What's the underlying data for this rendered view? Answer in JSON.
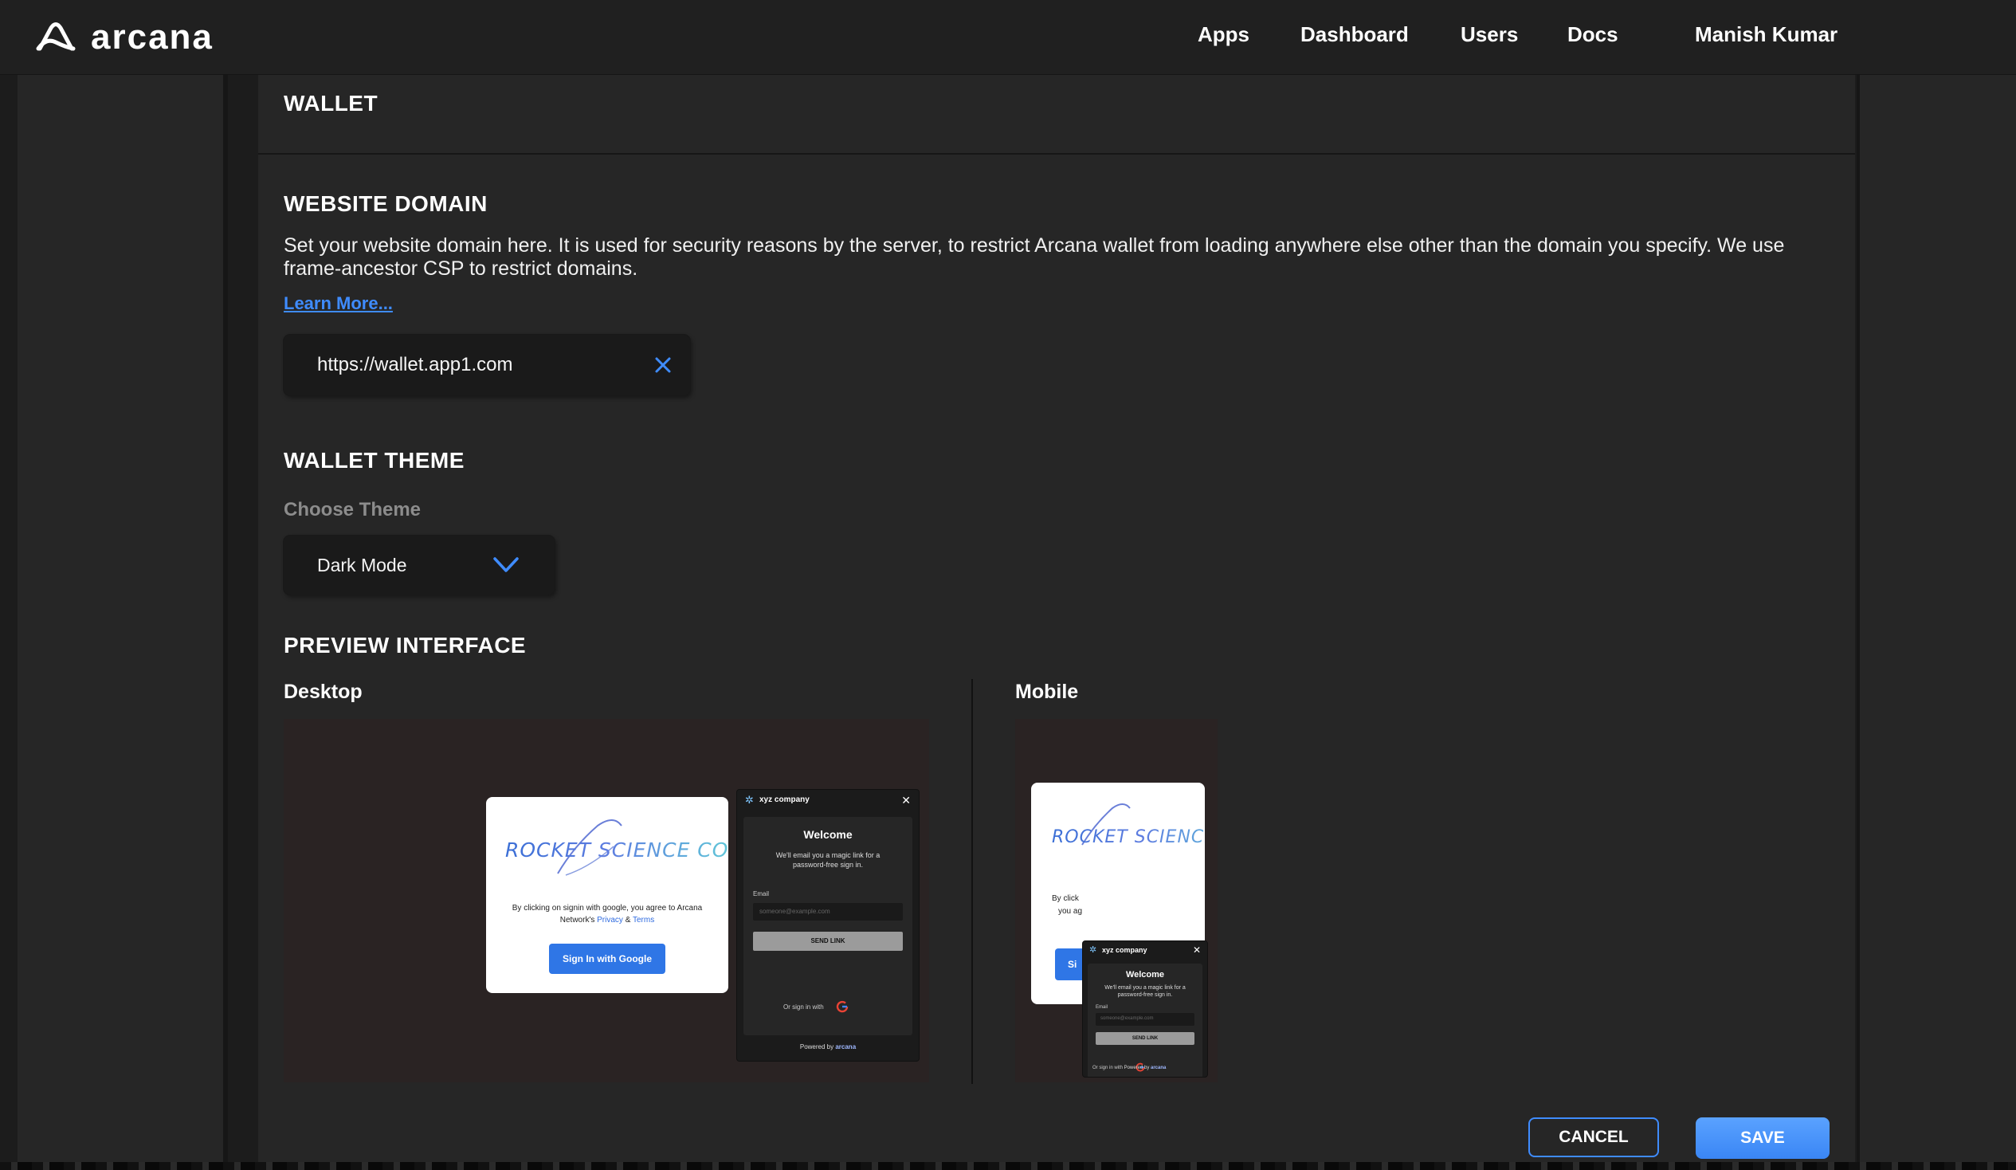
{
  "header": {
    "brand": "arcana",
    "nav": [
      "Apps",
      "Dashboard",
      "Users",
      "Docs"
    ],
    "user": "Manish Kumar"
  },
  "section_title": "WALLET",
  "website_domain": {
    "heading": "WEBSITE DOMAIN",
    "description": "Set your website domain here. It is used for security reasons by the server, to restrict Arcana wallet from loading anywhere else other than the domain you specify. We use frame-ancestor CSP to restrict domains.",
    "learn_more": "Learn More...",
    "value": "https://wallet.app1.com"
  },
  "wallet_theme": {
    "heading": "WALLET THEME",
    "label": "Choose Theme",
    "selected": "Dark Mode"
  },
  "preview": {
    "heading": "PREVIEW INTERFACE",
    "desktop_label": "Desktop",
    "mobile_label": "Mobile",
    "app": {
      "logo": "ROCKET SCIENCE CO.",
      "consent_prefix": "By clicking on signin with google, you agree to Arcana Network's",
      "privacy": "Privacy",
      "amp": "&",
      "terms": "Terms",
      "google_button": "Sign In with Google",
      "mobile_consent_fragment": "By click",
      "mobile_consent_fragment2": "you ag",
      "mobile_button_fragment": "Si"
    },
    "wallet": {
      "company": "xyz company",
      "welcome": "Welcome",
      "subtitle": "We'll email you a magic link for a password-free sign in.",
      "email_label": "Email",
      "email_placeholder": "someone@example.com",
      "send_link": "SEND LINK",
      "or_sign_in": "Or sign in with",
      "powered_by": "Powered by",
      "powered_brand": "arcana"
    }
  },
  "actions": {
    "cancel": "CANCEL",
    "save": "SAVE"
  },
  "colors": {
    "accent": "#3f8cff",
    "background": "#1c1c1c",
    "panel": "#262626"
  }
}
